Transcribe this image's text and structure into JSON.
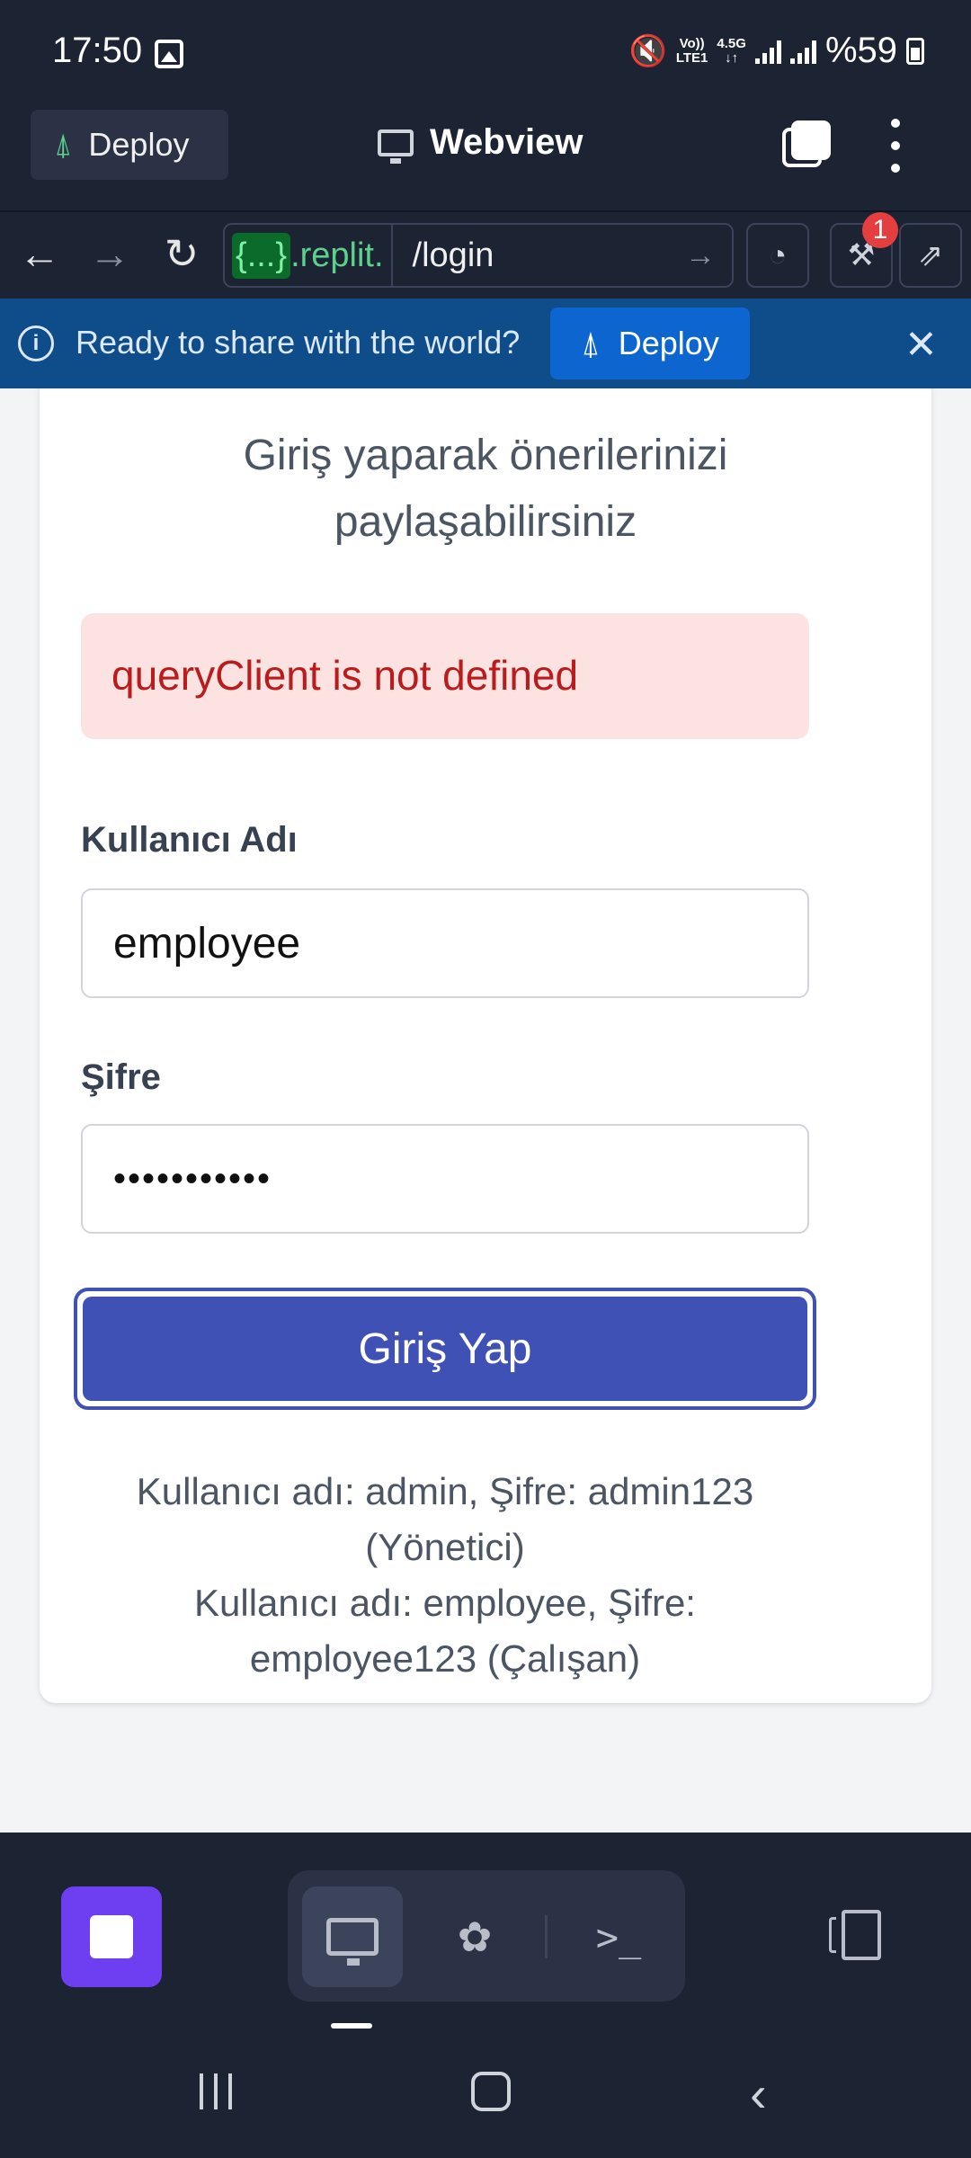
{
  "status_bar": {
    "time": "17:50",
    "network_top": "Vo))",
    "network_bottom": "LTE1",
    "data_top": "4.5G",
    "data_bottom": "↓↑",
    "battery": "%59"
  },
  "app_bar": {
    "deploy_label": "Deploy",
    "title": "Webview"
  },
  "url_bar": {
    "host_prefix": "{...}",
    "host_suffix": ".replit.",
    "path": "/login",
    "badge_count": "1"
  },
  "banner": {
    "text": "Ready to share with the world?",
    "deploy_label": "Deploy"
  },
  "login": {
    "subtitle_line1": "Giriş yaparak önerilerinizi",
    "subtitle_line2": "paylaşabilirsiniz",
    "error": "queryClient is not defined",
    "username_label": "Kullanıcı Adı",
    "username_value": "employee",
    "password_label": "Şifre",
    "password_value": "•••••••••••",
    "submit_label": "Giriş Yap",
    "hint_line1": "Kullanıcı adı: admin, Şifre: admin123",
    "hint_line2": "(Yönetici)",
    "hint_line3": "Kullanıcı adı: employee, Şifre:",
    "hint_line4": "employee123 (Çalışan)"
  },
  "colors": {
    "primary": "#3f51b5",
    "error_bg": "#fde2e2",
    "error_text": "#b91c1c",
    "banner": "#0f4c8a",
    "replit_green": "#5bd18b"
  }
}
